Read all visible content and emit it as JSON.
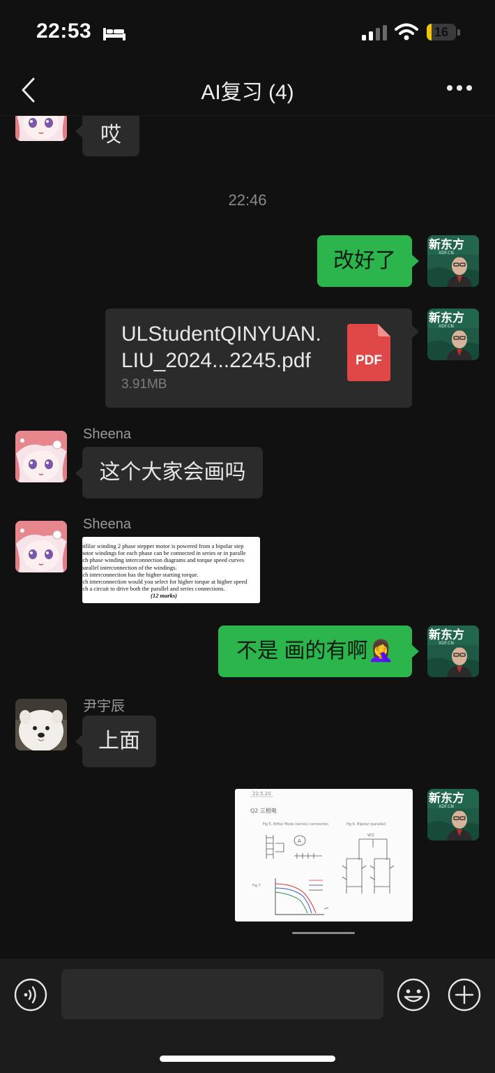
{
  "status": {
    "time": "22:53",
    "battery": "16",
    "battery_level": 0.16
  },
  "nav": {
    "title": "AI复习 (4)"
  },
  "messages": [
    {
      "type": "text",
      "side": "in",
      "text": "哎"
    },
    {
      "type": "timestamp",
      "text": "22:46"
    },
    {
      "type": "text",
      "side": "out",
      "text": "改好了"
    },
    {
      "type": "file",
      "side": "out",
      "file_name_line1": "ULStudentQINYUAN.",
      "file_name_line2": "LIU_2024...2245.pdf",
      "size": "3.91MB",
      "icon_label": "PDF"
    },
    {
      "type": "text",
      "side": "in",
      "sender": "Sheena",
      "text": "这个大家会画吗"
    },
    {
      "type": "image",
      "side": "in",
      "sender": "Sheena",
      "image_lines": [
        "bifilar winding 2 phase stepper motor is powered from a bipolar step",
        "notor windings for each phase can be connected in series or in paralle",
        "tch phase winding interconnection diagrams and torque speed curves",
        " parallel interconnection of the windings.",
        "ich interconnection has the higher starting torque.",
        "ich interconnection would you select for higher torque at higher speed",
        "tch a circuit to drive both the parallel and series connections.",
        "(12 marks)"
      ]
    },
    {
      "type": "text",
      "side": "out",
      "text": "不是 画的有啊🤦‍♀️"
    },
    {
      "type": "text",
      "side": "in",
      "sender": "尹宇辰",
      "text": "上面"
    },
    {
      "type": "image",
      "side": "out",
      "image_labels": [
        "22.5.20",
        "Q2 三相电",
        "Fig 5. Bifilar Mode (series) connection",
        "Fig 6. Bipolar (parallel)",
        "VCC",
        "Fig 7",
        "A"
      ]
    }
  ],
  "avatar_labels": {
    "teacher": "新东方",
    "teacher_sub": "XDF.CN"
  },
  "input": {
    "placeholder": ""
  },
  "icons": {
    "back": "chevron-left-icon",
    "more": "more-dots-icon",
    "voice": "voice-icon",
    "emoji": "emoji-icon",
    "plus": "plus-icon",
    "pdf": "pdf-file-icon",
    "signal": "signal-icon",
    "wifi": "wifi-icon",
    "sleep": "bed-icon"
  },
  "colors": {
    "outgoing_bubble": "#2cb44d",
    "incoming_bubble": "#2b2b2b",
    "background": "#111111",
    "pdf_red": "#e04848",
    "battery_yellow": "#f4c400"
  }
}
